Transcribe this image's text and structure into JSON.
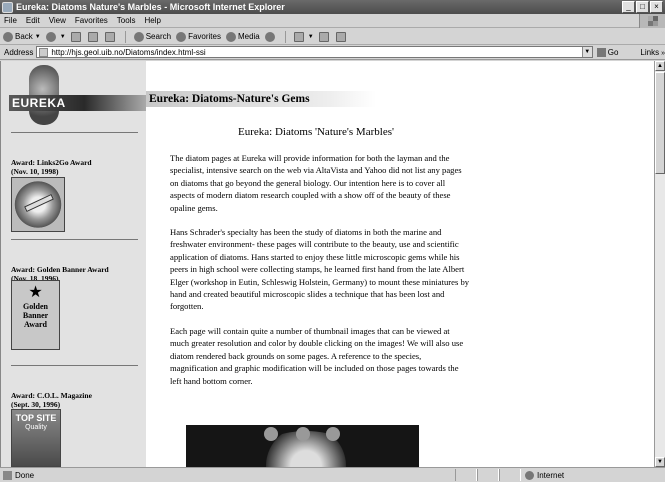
{
  "window": {
    "title": "Eureka: Diatoms Nature's Marbles - Microsoft Internet Explorer",
    "controls": [
      "_",
      "□",
      "×"
    ]
  },
  "menu": [
    "File",
    "Edit",
    "View",
    "Favorites",
    "Tools",
    "Help"
  ],
  "toolbar": {
    "back": "Back",
    "search": "Search",
    "favorites": "Favorites",
    "media": "Media"
  },
  "address": {
    "label": "Address",
    "url": "http://hjs.geol.uib.no/Diatoms/index.html-ssi",
    "go": "Go",
    "links": "Links"
  },
  "page": {
    "logo_text": "EUREKA",
    "header_title": "Eureka: Diatoms-Nature's Gems",
    "main_heading": "Eureka: Diatoms 'Nature's Marbles'",
    "paragraphs": [
      "The diatom pages at Eureka will provide information for both the layman and the specialist, intensive search on the web via AltaVista and Yahoo did not list any pages on diatoms that go beyond the general biology. Our intention here is to cover all aspects of modern diatom research coupled with a show off of the beauty of these opaline gems.",
      "Hans Schrader's specialty has been the study of diatoms in both the marine and freshwater environment- these pages will contribute to the beauty, use and scientific application of diatoms. Hans started to enjoy these little microscopic gems while his peers in high school were collecting stamps, he learned first hand from the late Albert Elger (workshop in Eutin, Schleswig Holstein, Germany) to mount these miniatures by hand and created beautiful microscopic slides a technique that has been lost and forgotten.",
      "Each page will contain quite a number of thumbnail images that can be viewed at much greater resolution and color by double clicking on the images! We will also use diatom rendered back grounds on some pages. A reference to the species, magnification and graphic modification will be included on those pages towards the left hand bottom corner."
    ],
    "awards": [
      {
        "label": "Award: Links2Go Award",
        "date": "(Nov. 10, 1998)"
      },
      {
        "label": "Award: Golden Banner Award",
        "date": "(Nov. 18, 1996)"
      },
      {
        "label": "Award: C.O.L. Magazine",
        "date": "(Sept. 30, 1996)"
      }
    ],
    "golden_banner_text": [
      "Golden",
      "Banner",
      "Award"
    ],
    "col_badge_text": [
      "TOP SITE",
      "Quality"
    ]
  },
  "status": {
    "text": "Done",
    "zone": "Internet"
  }
}
